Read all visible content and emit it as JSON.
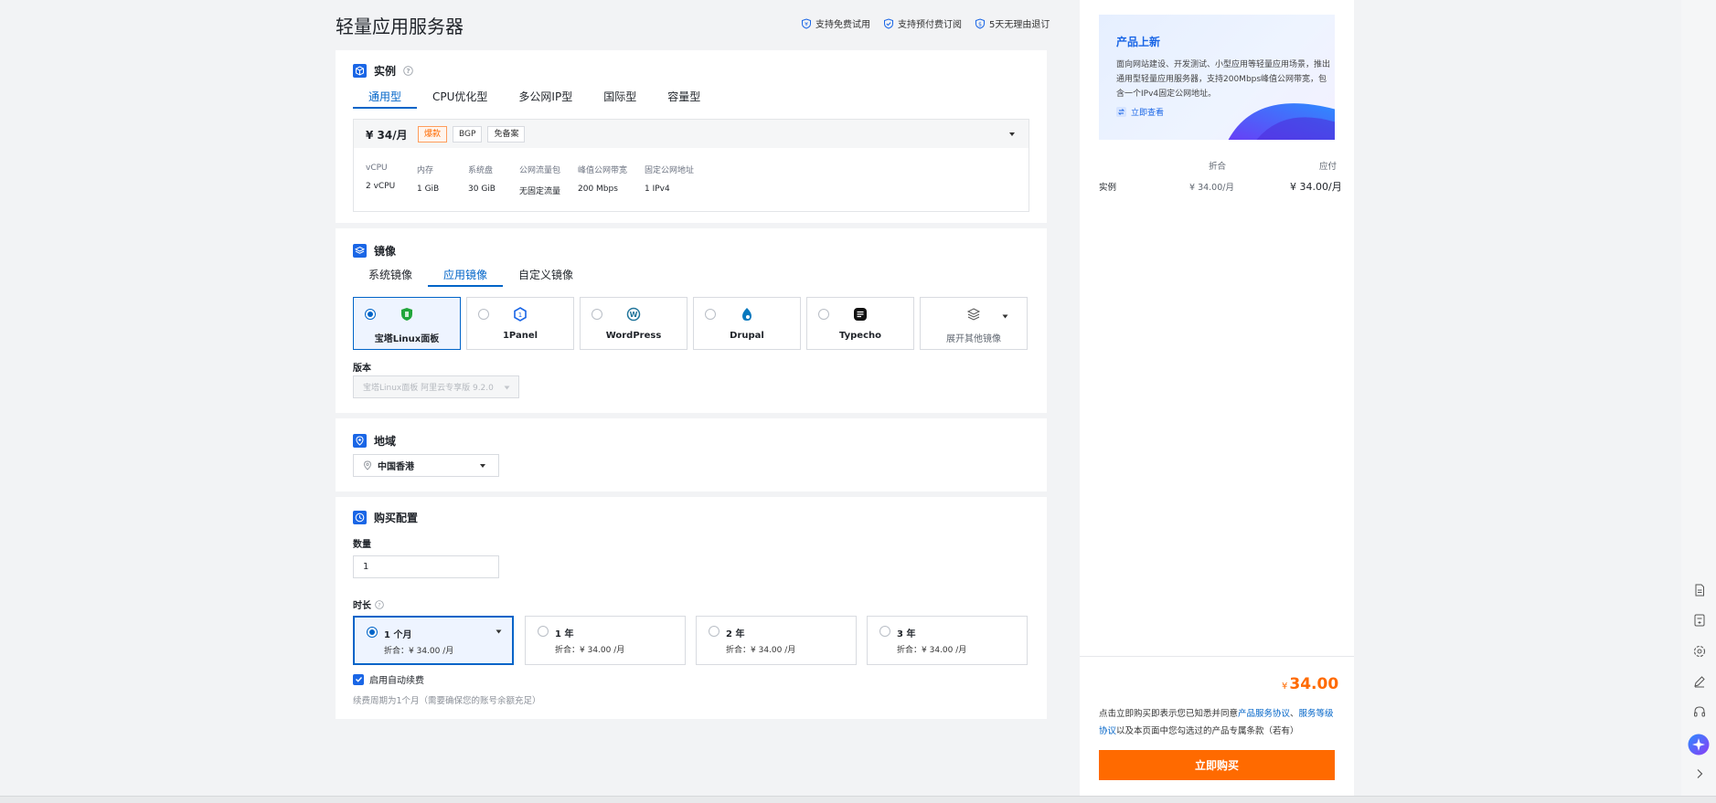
{
  "header": {
    "title": "轻量应用服务器",
    "guarantees": [
      "支持免费试用",
      "支持预付费订阅",
      "5天无理由退订"
    ]
  },
  "instance": {
    "title": "实例",
    "tabs": [
      "通用型",
      "CPU优化型",
      "多公网IP型",
      "国际型",
      "容量型"
    ],
    "active_tab": 0,
    "plan": {
      "price": "¥ 34/月",
      "tags": [
        "爆款",
        "BGP",
        "免备案"
      ],
      "specs": [
        {
          "k": "vCPU",
          "v": "2 vCPU"
        },
        {
          "k": "内存",
          "v": "1 GiB"
        },
        {
          "k": "系统盘",
          "v": "30 GiB"
        },
        {
          "k": "公网流量包",
          "v": "无固定流量"
        },
        {
          "k": "峰值公网带宽",
          "v": "200 Mbps"
        },
        {
          "k": "固定公网地址",
          "v": "1 IPv4"
        }
      ]
    }
  },
  "image": {
    "title": "镜像",
    "tabs": [
      "系统镜像",
      "应用镜像",
      "自定义镜像"
    ],
    "active_tab": 1,
    "cards": [
      "宝塔Linux面板",
      "1Panel",
      "WordPress",
      "Drupal",
      "Typecho",
      "展开其他镜像"
    ],
    "version_label": "版本",
    "version_value": "宝塔Linux面板 阿里云专享版 9.2.0"
  },
  "region": {
    "title": "地域",
    "value": "中国香港"
  },
  "purchase": {
    "title": "购买配置",
    "quantity_label": "数量",
    "quantity_value": "1",
    "duration_label": "时长",
    "durations": [
      {
        "name": "1 个月",
        "price": "折合：¥ 34.00 /月"
      },
      {
        "name": "1 年",
        "price": "折合：¥ 34.00 /月"
      },
      {
        "name": "2 年",
        "price": "折合：¥ 34.00 /月"
      },
      {
        "name": "3 年",
        "price": "折合：¥ 34.00 /月"
      }
    ],
    "auto_renew_label": "启用自动续费",
    "renew_note": "续费周期为1个月（需要确保您的账号余额充足）"
  },
  "promo": {
    "title": "产品上新",
    "text": "面向网站建设、开发测试、小型应用等轻量应用场景，推出通用型轻量应用服务器，支持200Mbps峰值公网带宽，包含一个IPv4固定公网地址。",
    "link": "立即查看"
  },
  "summary": {
    "col_discount": "折合",
    "col_payable": "应付",
    "row_name": "实例",
    "row_discount": "¥ 34.00/月",
    "row_payable": "¥ 34.00/月"
  },
  "checkout": {
    "currency": "¥",
    "total": "34.00",
    "agree_prefix": "点击立即购买即表示您已知悉并同意",
    "link1": "产品服务协议",
    "sep": "、",
    "link2": "服务等级协议",
    "agree_suffix": "以及本页面中您勾选过的产品专属条款（若有）",
    "buy_label": "立即购买"
  },
  "colors": {
    "accent": "#0064c8",
    "buy": "#ff6a00"
  }
}
